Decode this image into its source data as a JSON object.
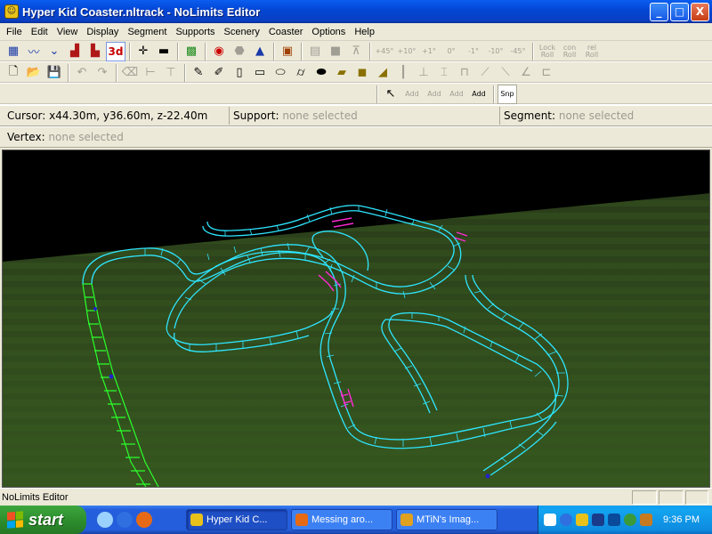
{
  "window": {
    "title": "Hyper Kid Coaster.nltrack - NoLimits Editor",
    "controls": {
      "minimize": "_",
      "maximize": "□",
      "close": "X"
    }
  },
  "menu": [
    "File",
    "Edit",
    "View",
    "Display",
    "Segment",
    "Supports",
    "Scenery",
    "Coaster",
    "Options",
    "Help"
  ],
  "toolbar1": {
    "labels": {
      "plus45": "+45°",
      "plus10": "+10°",
      "plus1": "+1°",
      "zero": "0°",
      "minus1": "-1°",
      "minus10": "-10°",
      "minus45": "-45°",
      "lock_roll": "Lock Roll",
      "con_roll": "con Roll",
      "rel_roll": "rel Roll"
    },
    "three_d": "3d"
  },
  "toolbar3": {
    "add_labels": [
      "Add",
      "Add",
      "Add",
      "Add"
    ],
    "snap": "Snp"
  },
  "status": {
    "cursor_label": "Cursor:",
    "cursor_value": "x44.30m, y36.60m, z-22.40m",
    "support_label": "Support:",
    "support_value": "none selected",
    "segment_label": "Segment:",
    "segment_value": "none selected",
    "vertex_label": "Vertex:",
    "vertex_value": "none selected"
  },
  "app_status": "NoLimits Editor",
  "taskbar": {
    "start": "start",
    "tasks": [
      "Hyper Kid C...",
      "Messing aro...",
      "MTiN's Imag..."
    ],
    "clock": "9:36 PM"
  },
  "colors": {
    "track": "#2ee6ff",
    "track_highlight": "#ff2ad4",
    "lift": "#2bff2b",
    "ground": "#2f4a1c"
  },
  "icons": {
    "toolbar1": [
      "track-nodes-icon",
      "curve-icon",
      "bend-icon",
      "train-icon",
      "coaster-icon",
      "3d-icon",
      "add-node-icon",
      "remove-node-icon",
      "grid-icon",
      "traffic-light-icon",
      "stop-icon",
      "pyramid-icon",
      "block-brake-icon",
      "grid-disabled-icon",
      "fill-disabled-icon",
      "terrain-disabled-icon"
    ],
    "toolbar2": [
      "new-file-icon",
      "open-file-icon",
      "save-file-icon",
      "undo-icon",
      "redo-icon",
      "support-eraser-icon",
      "support-join-icon",
      "support-tie-icon",
      "pencil-icon",
      "pencil-double-icon",
      "tube-thin-icon",
      "tube-medium-icon",
      "tube-wide-icon",
      "cylinder-icon",
      "cylinder-wide-icon",
      "beam-icon",
      "block-icon",
      "wedge-icon",
      "post-icon",
      "footer-icon",
      "stairs-icon",
      "frame-icon",
      "slope-icon",
      "ramp-icon",
      "angle-icon",
      "catwalk-icon"
    ]
  }
}
